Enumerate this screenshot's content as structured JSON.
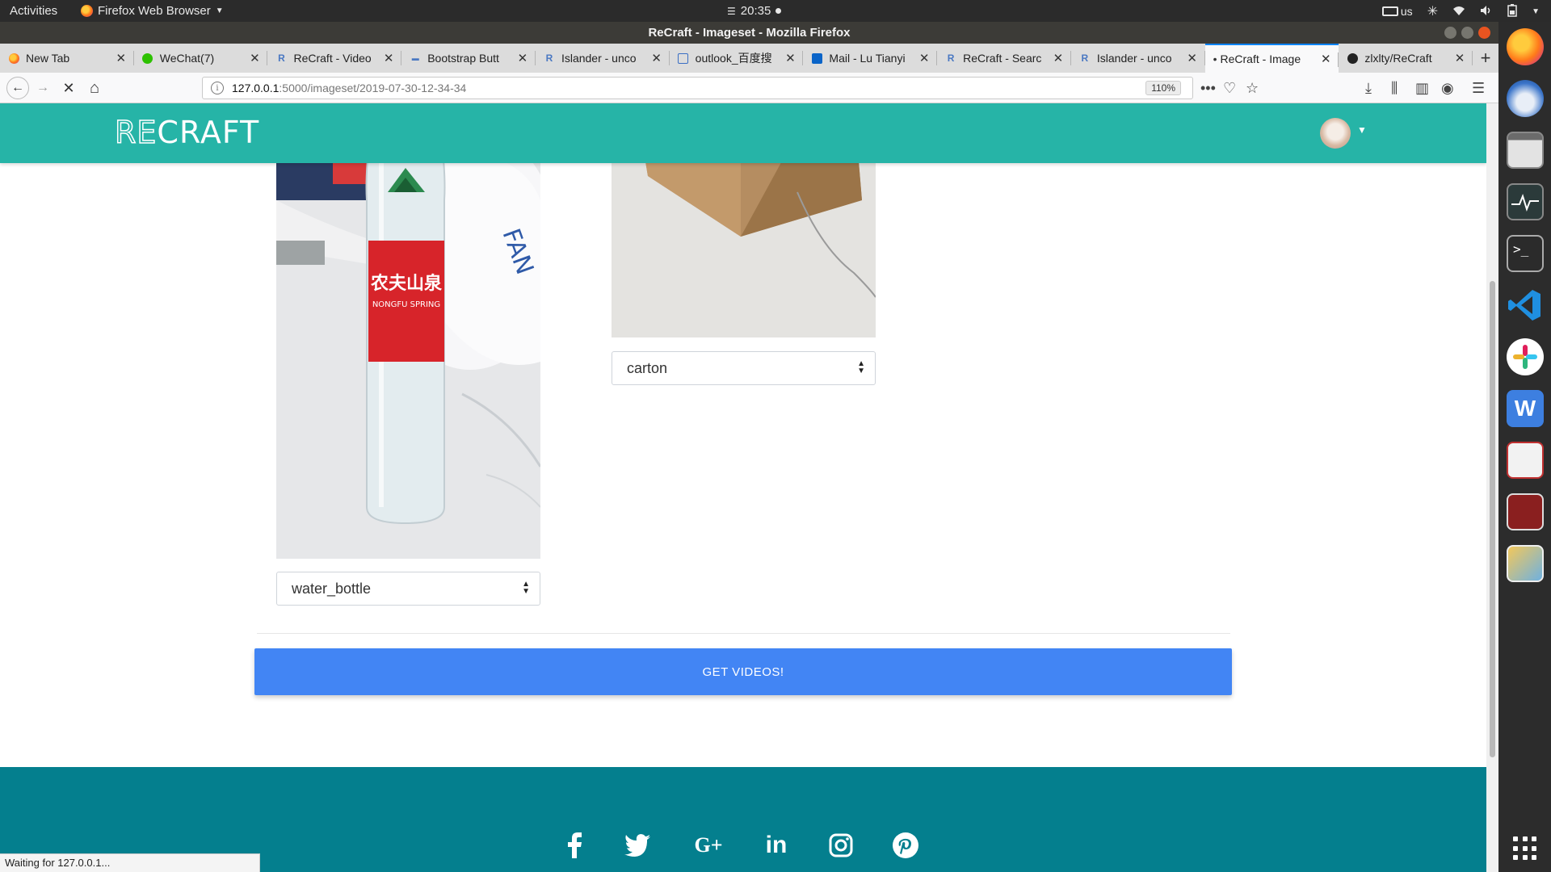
{
  "system": {
    "activities": "Activities",
    "app_menu": "Firefox Web Browser",
    "clock": "20:35",
    "keyboard_layout": "us"
  },
  "window": {
    "title": "ReCraft - Imageset - Mozilla Firefox"
  },
  "tabs": [
    {
      "label": "New Tab",
      "icon": "firefox-icon",
      "active": false
    },
    {
      "label": "WeChat(7)",
      "icon": "wechat-icon",
      "active": false
    },
    {
      "label": "ReCraft - Video",
      "icon": "recraft-icon",
      "active": false
    },
    {
      "label": "Bootstrap Butt",
      "icon": "bootstrap-icon",
      "active": false
    },
    {
      "label": "Islander - unco",
      "icon": "recraft-icon",
      "active": false
    },
    {
      "label": "outlook_百度搜",
      "icon": "baidu-icon",
      "active": false
    },
    {
      "label": "Mail - Lu Tianyi",
      "icon": "outlook-icon",
      "active": false
    },
    {
      "label": "ReCraft - Searc",
      "icon": "recraft-icon",
      "active": false
    },
    {
      "label": "Islander - unco",
      "icon": "recraft-icon",
      "active": false
    },
    {
      "label": "ReCraft - Image",
      "icon": "dot-icon",
      "active": true
    },
    {
      "label": "zlxlty/ReCraft",
      "icon": "github-icon",
      "active": false
    }
  ],
  "urlbar": {
    "host": "127.0.0.1",
    "path": ":5000/imageset/2019-07-30-12-34-34",
    "zoom": "110%"
  },
  "site": {
    "logo_outline": "RE",
    "logo_solid": "CRAFT",
    "accent_color": "#26b4a7",
    "footer_color": "#047f8e",
    "button_color": "#4285f4"
  },
  "images": [
    {
      "label": "water_bottle",
      "bottle_text_cn": "农夫山泉",
      "bottle_text_en": "NONGFU SPRING"
    },
    {
      "label": "carton"
    }
  ],
  "actions": {
    "get_videos": "GET VIDEOS!"
  },
  "footer": {
    "social": [
      "facebook-icon",
      "twitter-icon",
      "google-plus-icon",
      "linkedin-icon",
      "instagram-icon",
      "pinterest-icon"
    ],
    "google_plus_glyph": "G+",
    "linkedin_glyph": "in"
  },
  "status": {
    "text": "Waiting for 127.0.0.1..."
  }
}
